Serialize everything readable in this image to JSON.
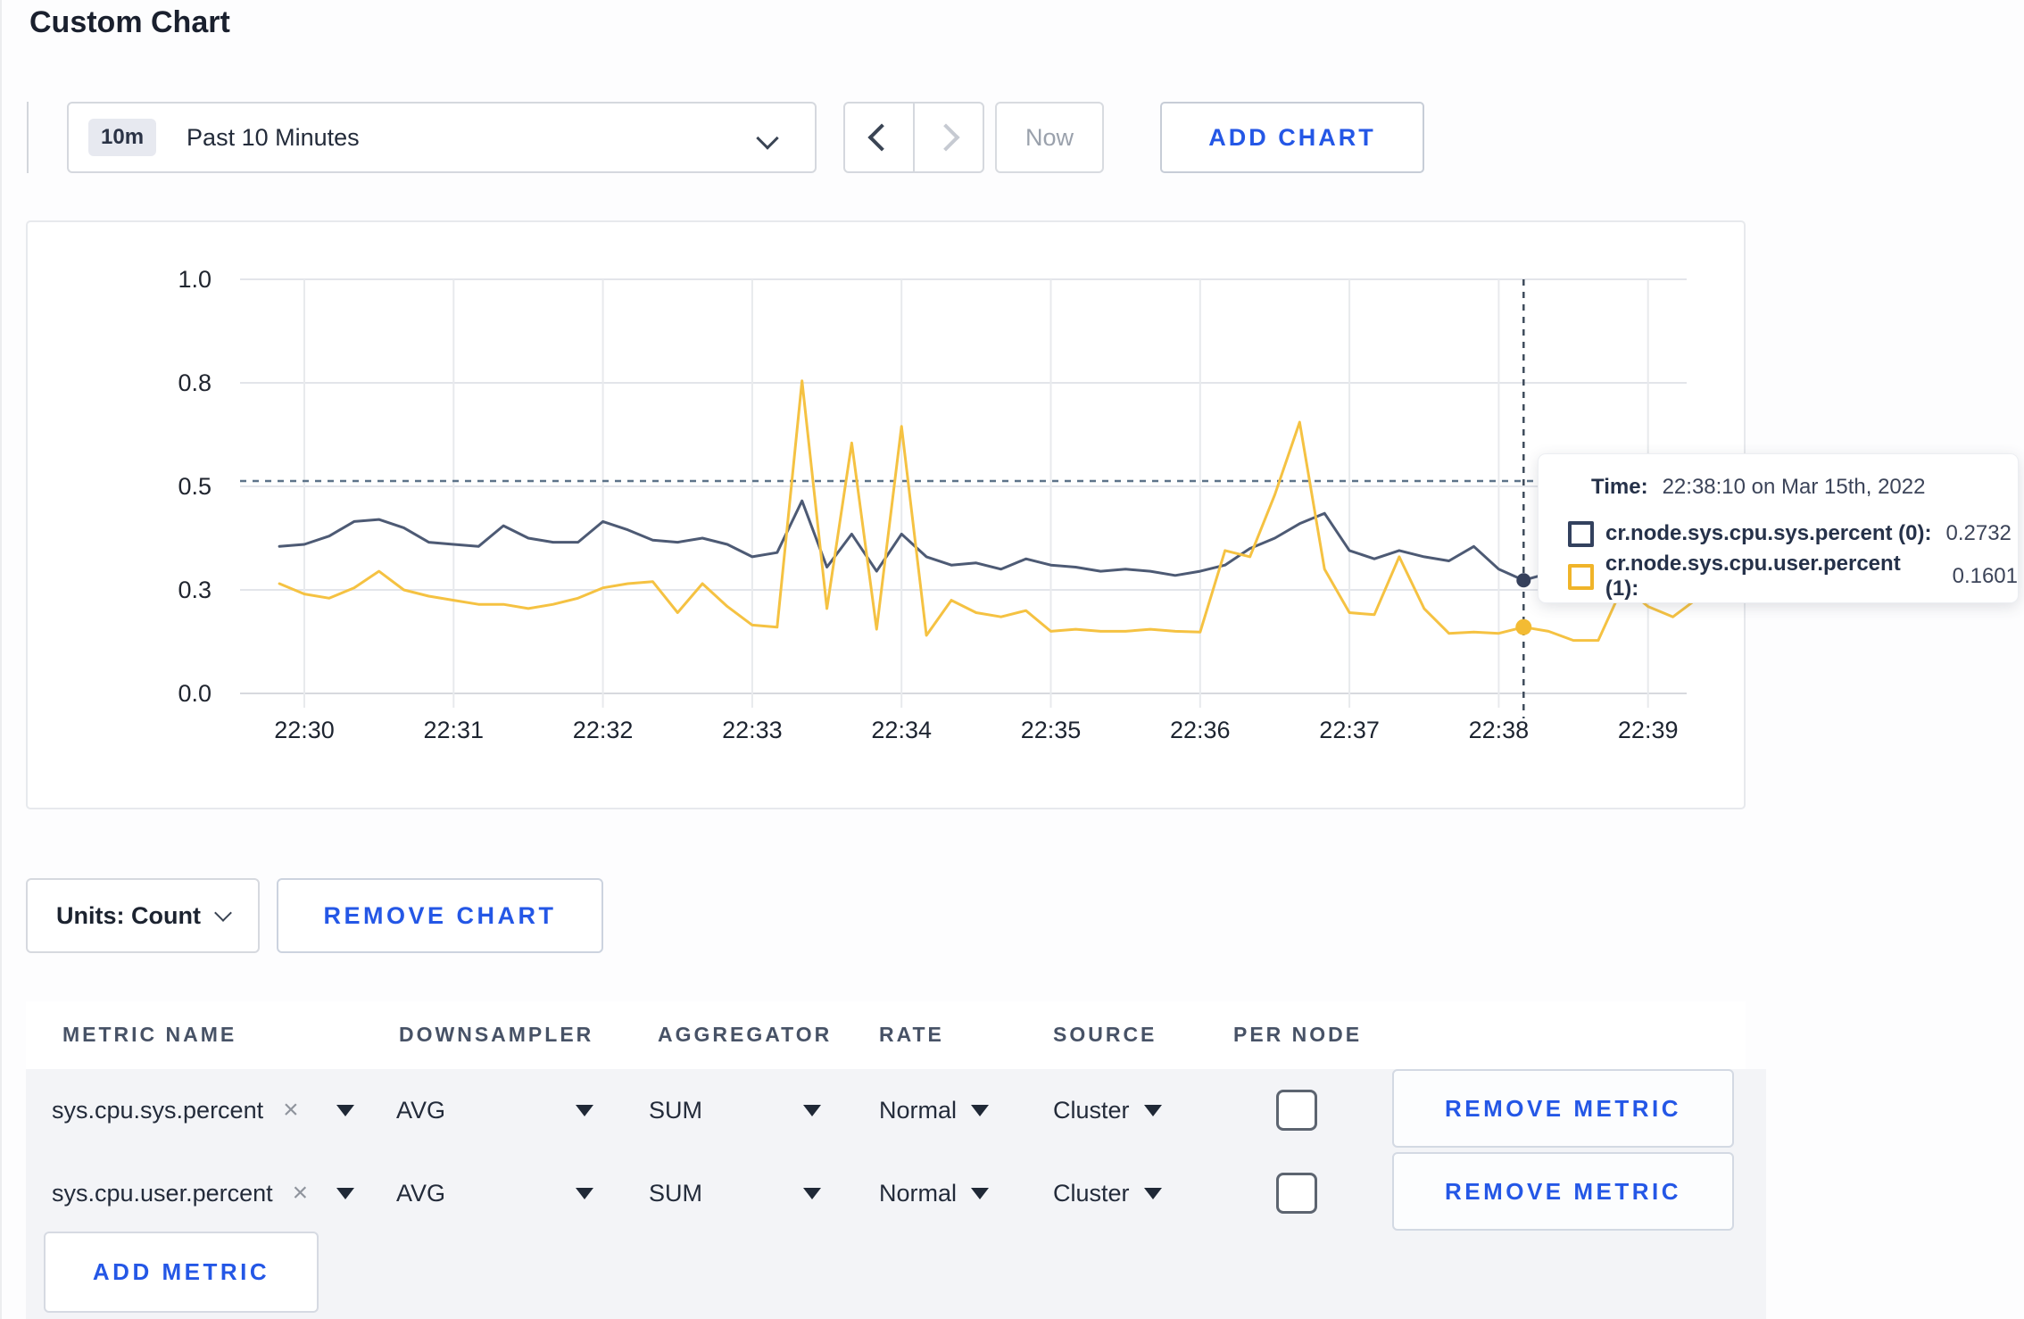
{
  "page": {
    "title": "Custom Chart"
  },
  "toolbar": {
    "time_range": {
      "badge": "10m",
      "label": "Past 10 Minutes"
    },
    "now_label": "Now",
    "add_chart_label": "ADD CHART"
  },
  "chart_controls": {
    "units_label": "Units: Count",
    "remove_chart_label": "REMOVE CHART"
  },
  "tooltip": {
    "time_label": "Time:",
    "time_value": "22:38:10 on Mar 15th, 2022",
    "series": [
      {
        "label": "cr.node.sys.cpu.sys.percent (0):",
        "value": "0.2732",
        "color": "#33415e"
      },
      {
        "label": "cr.node.sys.cpu.user.percent (1):",
        "value": "0.1601",
        "color": "#f0b429"
      }
    ]
  },
  "metrics_table": {
    "columns": [
      "METRIC NAME",
      "DOWNSAMPLER",
      "AGGREGATOR",
      "RATE",
      "SOURCE",
      "PER NODE"
    ],
    "rows": [
      {
        "metric_name": "sys.cpu.sys.percent",
        "close": "×",
        "downsampler": "AVG",
        "aggregator": "SUM",
        "rate": "Normal",
        "source": "Cluster",
        "per_node_checked": false,
        "remove_label": "REMOVE METRIC"
      },
      {
        "metric_name": "sys.cpu.user.percent",
        "close": "×",
        "downsampler": "AVG",
        "aggregator": "SUM",
        "rate": "Normal",
        "source": "Cluster",
        "per_node_checked": false,
        "remove_label": "REMOVE METRIC"
      }
    ],
    "add_metric_label": "ADD METRIC"
  },
  "chart_data": {
    "type": "line",
    "title": "",
    "xlabel": "",
    "ylabel": "",
    "ylim": [
      0,
      1
    ],
    "grid": true,
    "x_tick_labels": [
      "22:30",
      "22:31",
      "22:32",
      "22:33",
      "22:34",
      "22:35",
      "22:36",
      "22:37",
      "22:38",
      "22:39"
    ],
    "y_tick_labels": [
      "0.0",
      "0.3",
      "0.5",
      "0.8",
      "1.0"
    ],
    "y_tick_values": [
      0,
      0.25,
      0.5,
      0.75,
      1.0
    ],
    "x_start_offset_seconds": -10,
    "x_step_seconds": 10,
    "threshold_value": 0.513,
    "hover": {
      "index": 50,
      "time": "22:38:10",
      "values": [
        0.2732,
        0.1601
      ]
    },
    "series": [
      {
        "name": "cr.node.sys.cpu.sys.percent",
        "color": "#4d5a74",
        "values": [
          0.355,
          0.36,
          0.38,
          0.415,
          0.42,
          0.4,
          0.365,
          0.36,
          0.355,
          0.405,
          0.375,
          0.365,
          0.365,
          0.415,
          0.395,
          0.37,
          0.365,
          0.375,
          0.36,
          0.33,
          0.34,
          0.465,
          0.305,
          0.385,
          0.295,
          0.385,
          0.33,
          0.31,
          0.315,
          0.3,
          0.325,
          0.31,
          0.305,
          0.295,
          0.3,
          0.295,
          0.285,
          0.295,
          0.31,
          0.35,
          0.375,
          0.41,
          0.435,
          0.345,
          0.325,
          0.345,
          0.33,
          0.32,
          0.355,
          0.3,
          0.2732,
          0.29,
          0.3,
          0.295,
          0.3,
          0.305,
          0.295,
          0.3
        ]
      },
      {
        "name": "cr.node.sys.cpu.user.percent",
        "color": "#f5c242",
        "values": [
          0.265,
          0.24,
          0.23,
          0.255,
          0.295,
          0.25,
          0.235,
          0.225,
          0.215,
          0.215,
          0.205,
          0.215,
          0.23,
          0.255,
          0.265,
          0.27,
          0.195,
          0.265,
          0.21,
          0.165,
          0.16,
          0.755,
          0.205,
          0.605,
          0.155,
          0.645,
          0.14,
          0.225,
          0.195,
          0.185,
          0.2,
          0.15,
          0.155,
          0.15,
          0.15,
          0.155,
          0.15,
          0.148,
          0.345,
          0.33,
          0.48,
          0.655,
          0.3,
          0.195,
          0.19,
          0.33,
          0.205,
          0.145,
          0.148,
          0.145,
          0.1601,
          0.15,
          0.128,
          0.128,
          0.26,
          0.21,
          0.185,
          0.23
        ]
      }
    ]
  }
}
